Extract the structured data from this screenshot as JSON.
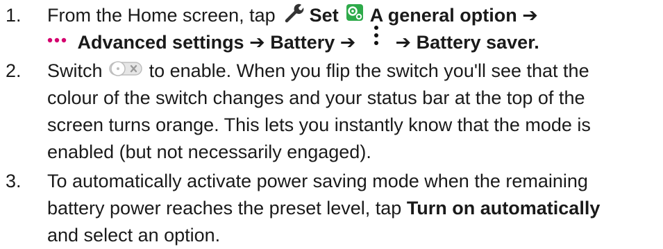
{
  "steps": [
    {
      "number": "1.",
      "line1": {
        "lead": "From the Home screen, tap",
        "set_label": "Set",
        "general_label": "A general option",
        "arrow": "➔"
      },
      "line2": {
        "advanced_label": "Advanced settings",
        "arrow1": "➔",
        "battery_label": "Battery",
        "arrow2": "➔",
        "arrow3": "➔",
        "saver_label": "Battery saver."
      },
      "icons": [
        "wrench-icon",
        "settings-gear-icon",
        "more-dots-icon",
        "kebab-menu-icon"
      ]
    },
    {
      "number": "2.",
      "lead": "Switch",
      "line1_rest": "to enable. When you flip the switch you'll see that the",
      "line2": "colour of the switch changes and your status bar at the top of the",
      "line3": "screen turns orange. This lets you instantly know that the mode is",
      "line4": "enabled (but not necessarily engaged).",
      "icons": [
        "toggle-switch-off-icon"
      ]
    },
    {
      "number": "3.",
      "line1": "To automatically activate power saving mode when the remaining",
      "line2_lead": "battery power reaches the preset level, tap",
      "line2_bold": "Turn on automatically",
      "line3": "and select an option."
    }
  ],
  "colors": {
    "text": "#1a1a1a",
    "accent_magenta": "#d4006e",
    "icon_green": "#2eaa4a",
    "toggle_gray": "#bdbdbd"
  }
}
